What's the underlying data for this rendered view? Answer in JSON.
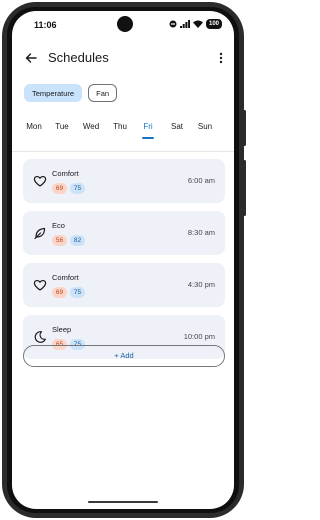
{
  "status_bar": {
    "time": "11:06",
    "battery": "100"
  },
  "app_bar": {
    "title": "Schedules"
  },
  "chips": [
    {
      "label": "Temperature",
      "selected": true
    },
    {
      "label": "Fan",
      "selected": false
    }
  ],
  "days": [
    "Mon",
    "Tue",
    "Wed",
    "Thu",
    "Fri",
    "Sat",
    "Sun"
  ],
  "selected_day": "Fri",
  "schedule": [
    {
      "name": "Comfort",
      "heat": "69",
      "cool": "75",
      "time": "6:00 am",
      "icon": "heart-icon"
    },
    {
      "name": "Eco",
      "heat": "56",
      "cool": "82",
      "time": "8:30 am",
      "icon": "leaf-icon"
    },
    {
      "name": "Comfort",
      "heat": "69",
      "cool": "75",
      "time": "4:30 pm",
      "icon": "heart-icon"
    },
    {
      "name": "Sleep",
      "heat": "65",
      "cool": "75",
      "time": "10:00 pm",
      "icon": "moon-icon"
    }
  ],
  "add_button": {
    "label": "+ Add"
  },
  "colors": {
    "accent": "#1a73c8",
    "chip_selected": "#c9e3fb",
    "card_bg": "#eef1f7",
    "heat": "#c0451a",
    "cool": "#1e5ea8"
  }
}
